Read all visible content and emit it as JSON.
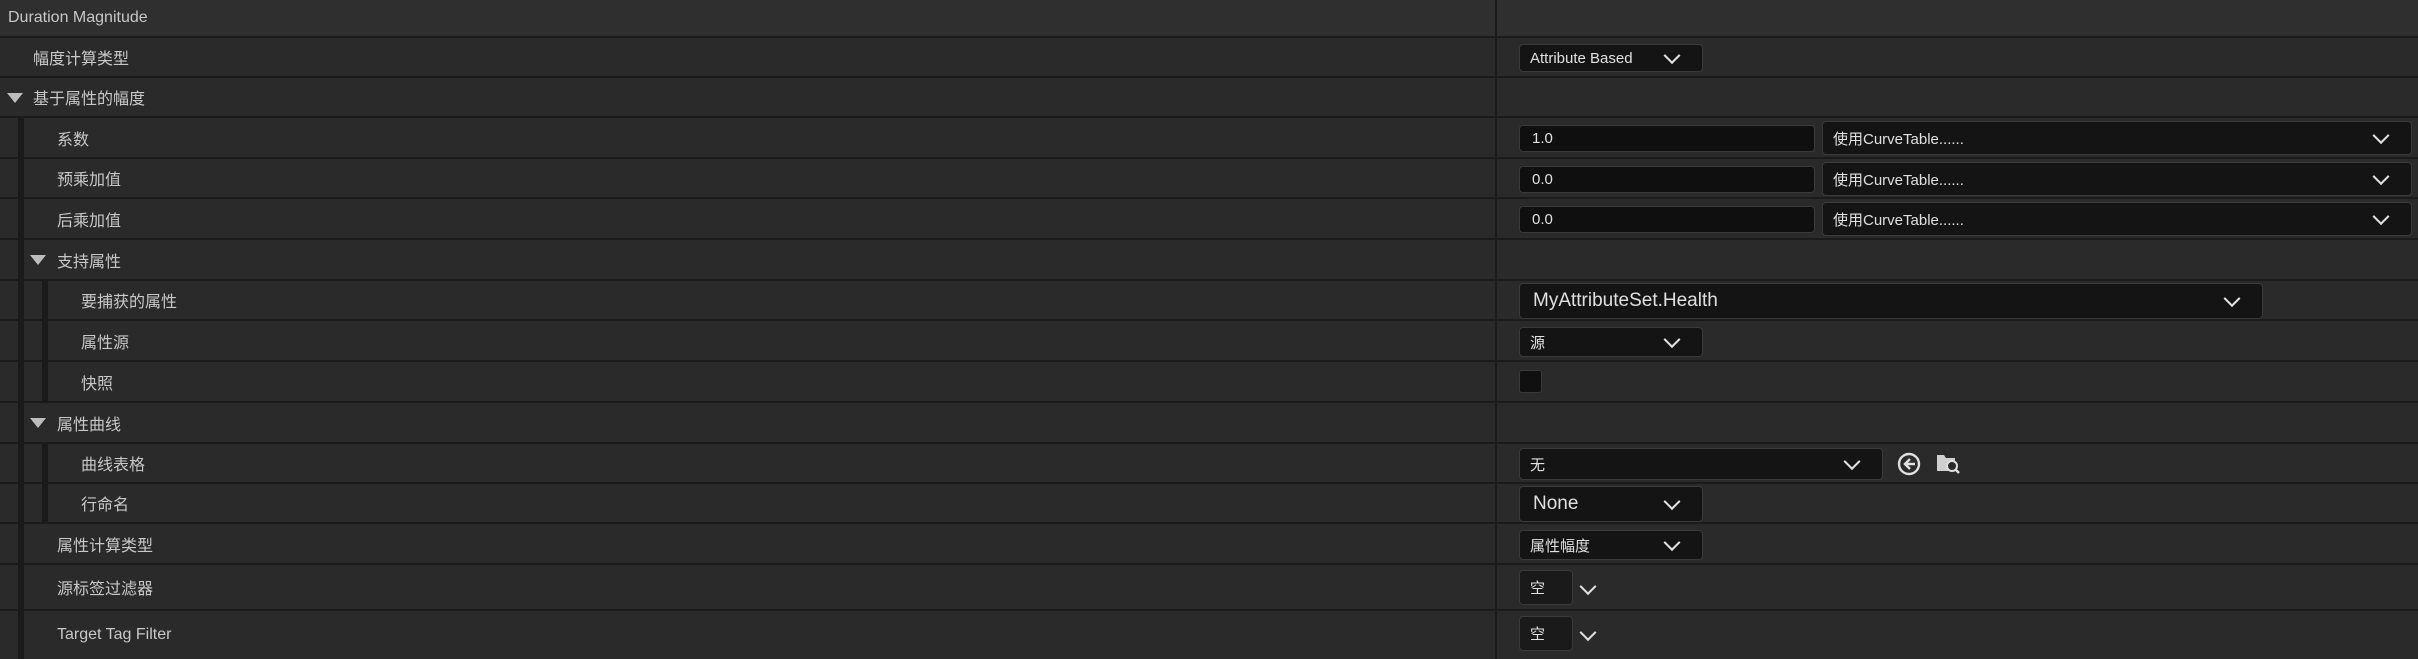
{
  "section_title": "Duration Magnitude",
  "rows": {
    "calc_type": {
      "label": "幅度计算类型",
      "value": "Attribute Based"
    },
    "attr_based": {
      "label": "基于属性的幅度"
    },
    "coefficient": {
      "label": "系数",
      "value": "1.0",
      "curve": "使用CurveTable......"
    },
    "pre_add": {
      "label": "预乘加值",
      "value": "0.0",
      "curve": "使用CurveTable......"
    },
    "post_add": {
      "label": "后乘加值",
      "value": "0.0",
      "curve": "使用CurveTable......"
    },
    "backing_attr": {
      "label": "支持属性"
    },
    "captured_attr": {
      "label": "要捕获的属性",
      "value": "MyAttributeSet.Health"
    },
    "attr_source": {
      "label": "属性源",
      "value": "源"
    },
    "snapshot": {
      "label": "快照",
      "checked": false
    },
    "attr_curve": {
      "label": "属性曲线"
    },
    "curve_table": {
      "label": "曲线表格",
      "value": "无"
    },
    "row_name": {
      "label": "行命名",
      "value": "None"
    },
    "attr_calc_type": {
      "label": "属性计算类型",
      "value": "属性幅度"
    },
    "source_tag_filter": {
      "label": "源标签过滤器",
      "value": "空"
    },
    "target_tag_filter": {
      "label": "Target Tag Filter",
      "value": "空"
    }
  },
  "icons": {
    "reset": "reset-arrow-icon",
    "browse": "browse-folder-icon",
    "expand": "chevron-down-icon"
  }
}
